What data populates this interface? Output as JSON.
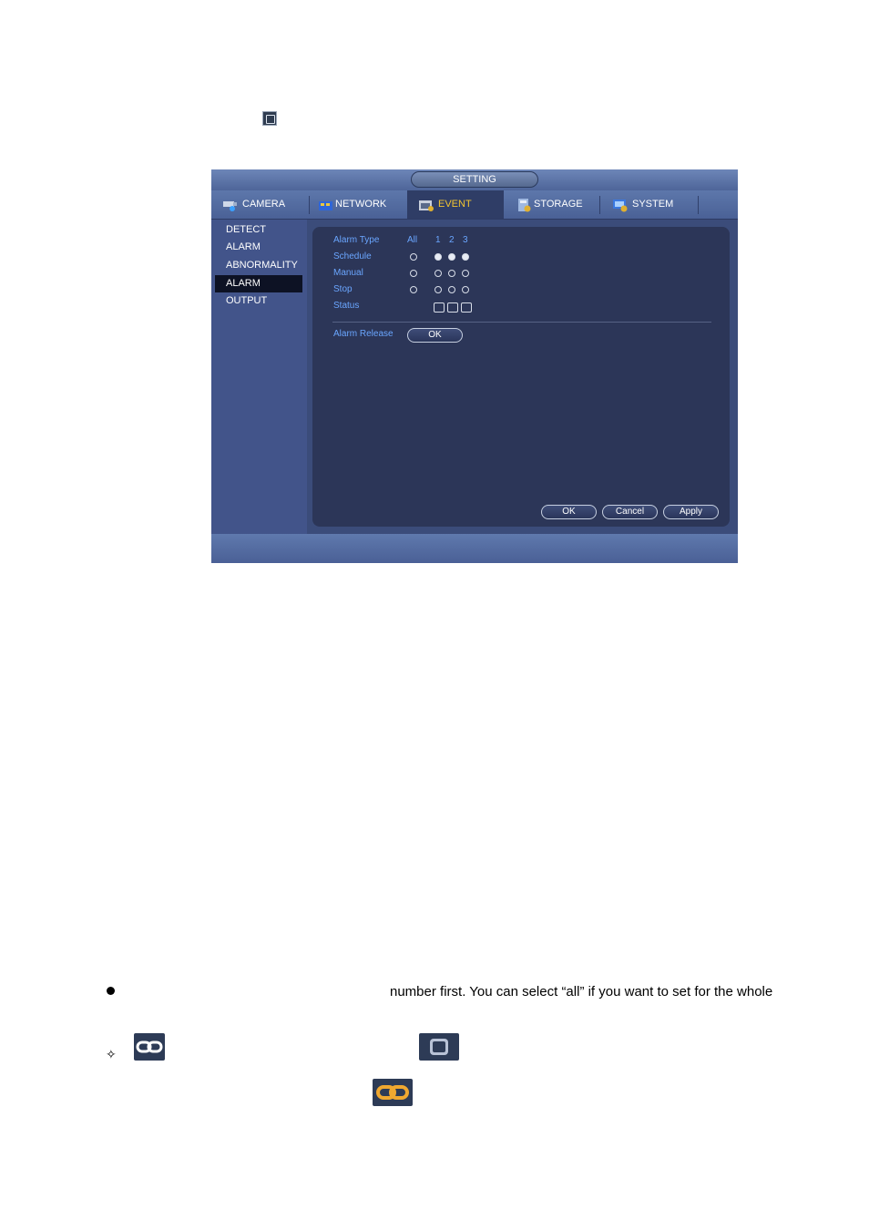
{
  "window": {
    "title": "SETTING",
    "tabs": [
      {
        "label": "CAMERA",
        "icon": "camera-icon",
        "active": false
      },
      {
        "label": "NETWORK",
        "icon": "network-icon",
        "active": false
      },
      {
        "label": "EVENT",
        "icon": "event-icon",
        "active": true
      },
      {
        "label": "STORAGE",
        "icon": "storage-icon",
        "active": false
      },
      {
        "label": "SYSTEM",
        "icon": "system-icon",
        "active": false
      }
    ],
    "sidebar": [
      {
        "label": "DETECT",
        "active": false
      },
      {
        "label": "ALARM",
        "active": false
      },
      {
        "label": "ABNORMALITY",
        "active": false
      },
      {
        "label": "ALARM OUTPUT",
        "active": true
      }
    ],
    "alarm_output": {
      "header_label": "Alarm Type",
      "all_label": "All",
      "channels": [
        "1",
        "2",
        "3"
      ],
      "rows": [
        {
          "label": "Schedule",
          "all": false,
          "channels": [
            true,
            true,
            true
          ]
        },
        {
          "label": "Manual",
          "all": false,
          "channels": [
            false,
            false,
            false
          ]
        },
        {
          "label": "Stop",
          "all": false,
          "channels": [
            false,
            false,
            false
          ]
        }
      ],
      "status_label": "Status",
      "status": [
        false,
        false,
        false
      ],
      "release_label": "Alarm Release",
      "release_button": "OK"
    },
    "buttons": {
      "ok": "OK",
      "cancel": "Cancel",
      "apply": "Apply"
    }
  },
  "document": {
    "bullet_text": "number first. You can select “all” if you want to set for the whole"
  },
  "colors": {
    "accent": "#f2c431",
    "label": "#6aa6ff",
    "panel": "#2c3658"
  }
}
